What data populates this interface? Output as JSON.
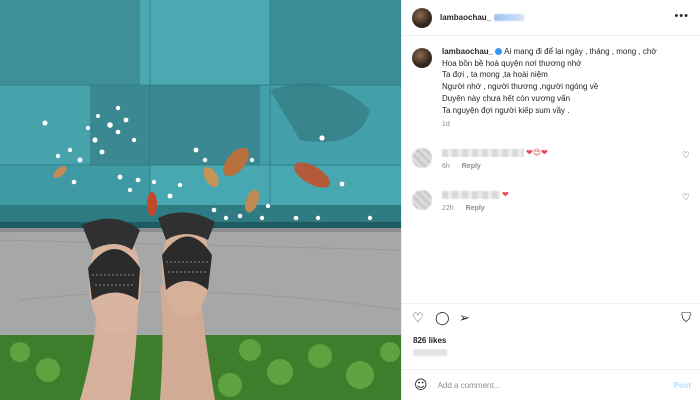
{
  "post": {
    "username": "lambaochau_",
    "more_icon": "more-horizontal-icon",
    "caption_lines": [
      "Ai mang đi để lại ngày , tháng , mong , chờ",
      "Hoa bồn bề hoà quyện nơi thương nhớ",
      "Ta đợi , ta mong ,ta hoài niệm",
      "Người nhớ , người thương ,người ngóng về",
      "Duyên này chưa hết còn vương vấn",
      "Ta nguyện đợi người kiếp sum vầy ."
    ],
    "caption_time": "1d"
  },
  "comments": [
    {
      "emojis": "❤😍❤",
      "time": "6h",
      "reply": "Reply"
    },
    {
      "emojis": "❤",
      "time": "22h",
      "reply": "Reply"
    }
  ],
  "actions": {
    "like_icon": "heart-outline-icon",
    "comment_icon": "comment-icon",
    "share_icon": "send-icon",
    "save_icon": "bookmark-icon"
  },
  "likes": "826 likes",
  "add_comment": {
    "placeholder": "Add a comment...",
    "post_label": "Post"
  },
  "colors": {
    "accent": "#0095f6",
    "post_disabled": "#b2dffc",
    "heart": "#ed4956",
    "verified": "#3897f0"
  }
}
